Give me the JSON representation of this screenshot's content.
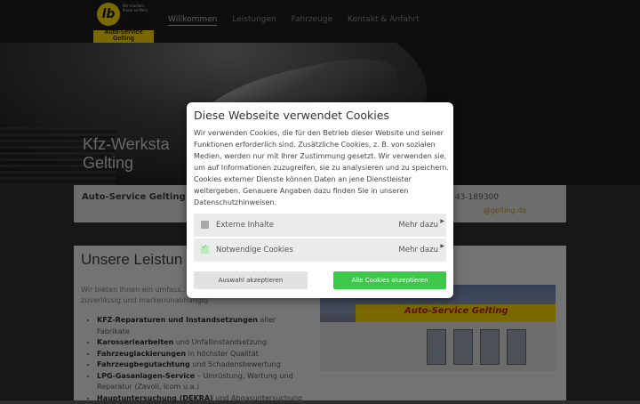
{
  "logo": {
    "mark": "lb",
    "slogan": "Wir machen Ihnen es Mehr",
    "name": "Auto-Service Gelting"
  },
  "nav": {
    "items": [
      "Willkommen",
      "Leistungen",
      "Fahrzeuge",
      "Kontakt & Anfahrt"
    ]
  },
  "hero": {
    "title_line1": "Kfz-Werksta",
    "title_line2": "Gelting"
  },
  "info": {
    "name": "Auto-Service Gelting",
    "phone": "43-189300",
    "email": "@gelting.de"
  },
  "leistungen": {
    "title": "Unsere Leistun",
    "intro": "Wir bieten Ihnen ein umfass… Ihr Fahrzeug – kompetent, zuverlässig und markenunabhängig",
    "services": [
      {
        "bold": "KFZ-Reparaturen und Instandsetzungen",
        "rest": " aller Fabrikate"
      },
      {
        "bold": "Karosseriearbeiten",
        "rest": " und Unfallinstandsetzung"
      },
      {
        "bold": "Fahrzeuglackierungen",
        "rest": " in höchster Qualität"
      },
      {
        "bold": "Fahrzeugbegutachtung",
        "rest": " und Schadensbewertung"
      },
      {
        "bold": "LPG-Gasanlagen-Service",
        "rest": " – Umrüstung, Wartung und Reparatur (Zavoli, Icom u.a.)"
      },
      {
        "bold": "Hauptuntersuchung (DEKRA)",
        "rest": " und Abgasuntersuchung"
      }
    ],
    "photo_sign": "Auto-Service Gelting"
  },
  "cookie": {
    "title": "Diese Webseite verwendet Cookies",
    "text": "Wir verwenden Cookies, die für den Betrieb dieser Website und seiner Funktionen erforderlich sind. Zusätzliche Cookies, z. B. von sozialen Medien, werden nur mit Ihrer Zustimmung gesetzt. Wir verwenden sie, um auf Informationen zuzugreifen, sie zu analysieren und zu speichern. Cookies externer Dienste können Daten an jene Dienstleister weitergeben. Genauere Angaben dazu finden Sie in unseren Datenschutzhinweisen.",
    "rows": [
      {
        "label": "Externe Inhalte",
        "more": "Mehr dazu",
        "checked": false
      },
      {
        "label": "Notwendige Cookies",
        "more": "Mehr dazu",
        "checked": true
      }
    ],
    "btn_selection": "Auswahl akzeptieren",
    "btn_all": "Alle Cookies akzeptieren"
  }
}
